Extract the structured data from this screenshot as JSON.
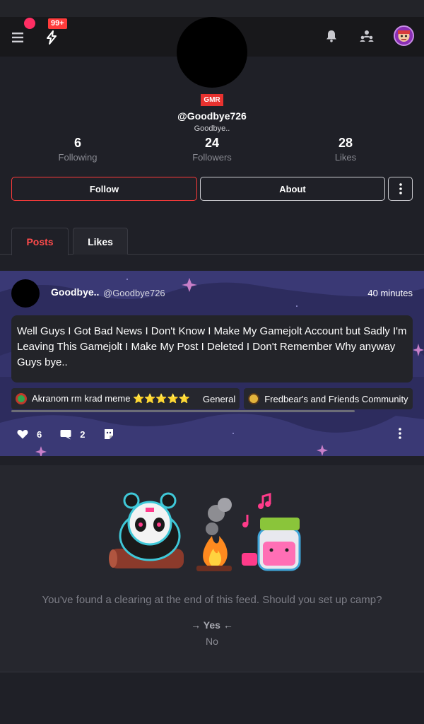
{
  "topbar": {
    "notification_badge": "99+"
  },
  "profile": {
    "badge": "GMR",
    "handle": "@Goodbye726",
    "display_name": "Goodbye..",
    "stats": [
      {
        "value": "6",
        "label": "Following"
      },
      {
        "value": "24",
        "label": "Followers"
      },
      {
        "value": "28",
        "label": "Likes"
      }
    ],
    "follow_label": "Follow",
    "about_label": "About"
  },
  "tabs": [
    {
      "label": "Posts"
    },
    {
      "label": "Likes"
    }
  ],
  "post": {
    "author_name": "Goodbye..",
    "author_handle": "@Goodbye726",
    "time": "40 minutes",
    "body": "Well Guys I Got Bad News I Don't Know I Make My Gamejolt Account but Sadly I'm Leaving This Gamejolt I Make My Post I Deleted I Don't Remember Why anyway Guys bye..",
    "communities": [
      {
        "name": "Akranom rm krad meme ⭐⭐⭐⭐⭐",
        "channel": "General"
      },
      {
        "name": "Fredbear's and Friends Community"
      }
    ],
    "likes": "6",
    "comments": "2"
  },
  "feed_end": {
    "message": "You've found a clearing at the end of this feed. Should you set up camp?",
    "yes_label": "Yes",
    "no_label": "No"
  },
  "colors": {
    "accent": "#ff3b3b",
    "background": "#1f2027",
    "topbar": "#18181b"
  }
}
